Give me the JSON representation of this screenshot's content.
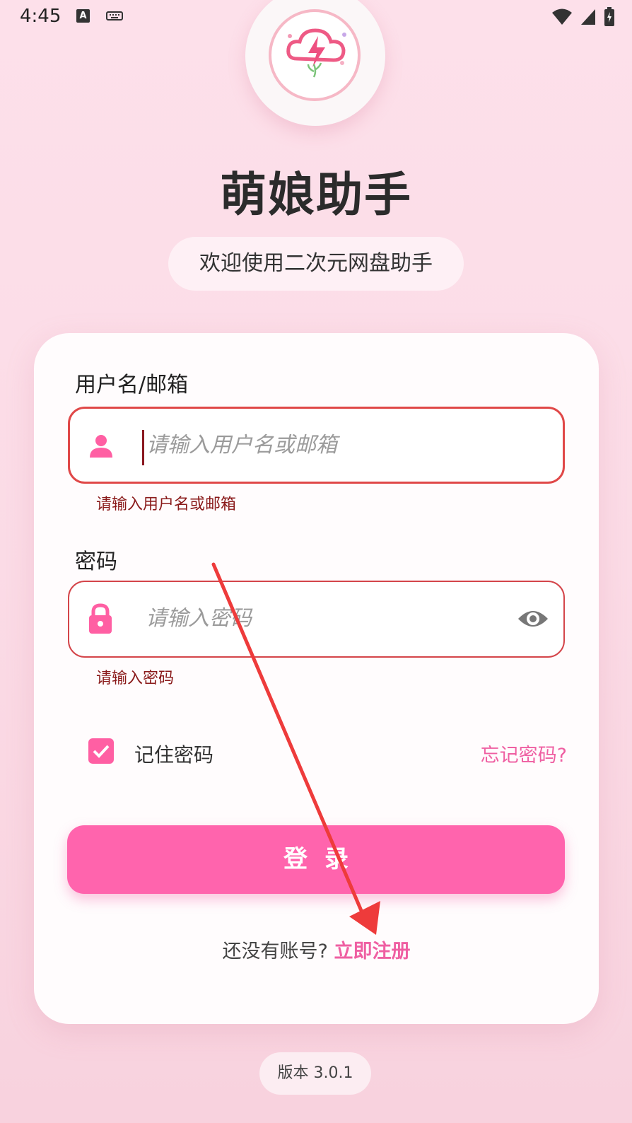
{
  "status_bar": {
    "time": "4:45",
    "icons": [
      "a-icon",
      "keyboard-icon",
      "wifi-icon",
      "signal-icon",
      "battery-icon"
    ]
  },
  "header": {
    "app_title": "萌娘助手",
    "subtitle": "欢迎使用二次元网盘助手"
  },
  "form": {
    "username": {
      "label": "用户名/邮箱",
      "placeholder": "请输入用户名或邮箱",
      "error": "请输入用户名或邮箱",
      "icon": "person-icon"
    },
    "password": {
      "label": "密码",
      "placeholder": "请输入密码",
      "error": "请输入密码",
      "icon": "lock-icon",
      "toggle_icon": "eye-icon"
    },
    "remember": {
      "label": "记住密码",
      "checked": true
    },
    "forgot_label": "忘记密码?",
    "login_label": "登录",
    "register_prompt": "还没有账号?",
    "register_link": "立即注册"
  },
  "footer": {
    "version": "版本 3.0.1"
  },
  "colors": {
    "accent": "#ff64ad",
    "error": "#e04848",
    "link": "#ef5fa2"
  }
}
